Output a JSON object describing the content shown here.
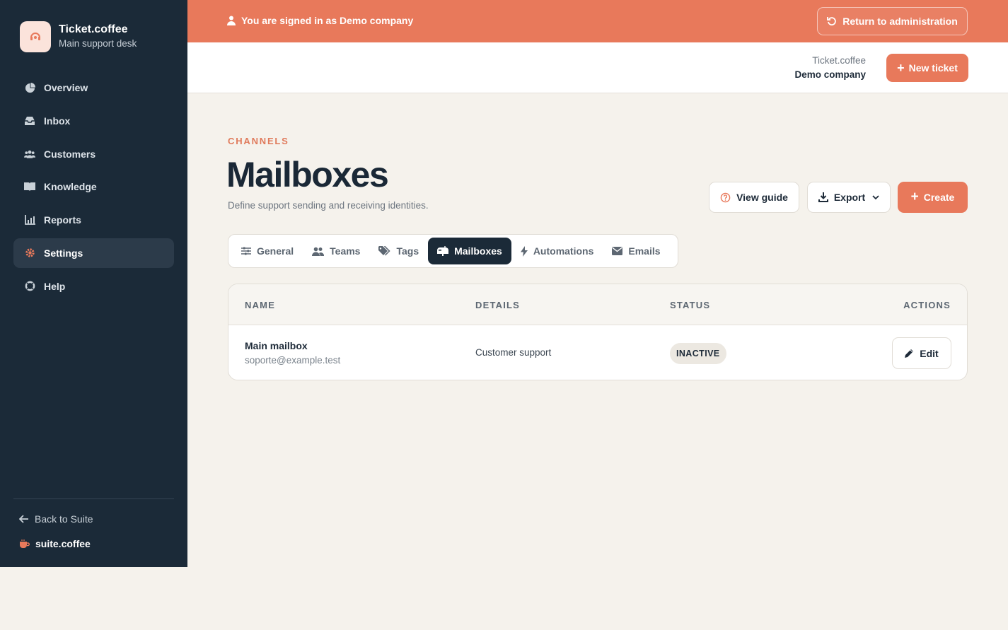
{
  "brand": {
    "name": "Ticket.coffee",
    "subtitle": "Main support desk",
    "logo_icon": "headset-icon"
  },
  "sidebar": {
    "items": [
      {
        "label": "Overview",
        "icon": "pie-chart-icon",
        "active": false
      },
      {
        "label": "Inbox",
        "icon": "inbox-icon",
        "active": false
      },
      {
        "label": "Customers",
        "icon": "users-icon",
        "active": false
      },
      {
        "label": "Knowledge",
        "icon": "book-icon",
        "active": false
      },
      {
        "label": "Reports",
        "icon": "chart-icon",
        "active": false
      },
      {
        "label": "Settings",
        "icon": "gear-icon",
        "active": true
      },
      {
        "label": "Help",
        "icon": "lifebuoy-icon",
        "active": false
      }
    ],
    "back_label": "Back to Suite",
    "suite_name": "suite.coffee"
  },
  "banner": {
    "text": "You are signed in as Demo company",
    "return_label": "Return to administration"
  },
  "header": {
    "app_name": "Ticket.coffee",
    "company": "Demo company",
    "new_ticket_label": "New ticket"
  },
  "page": {
    "eyebrow": "CHANNELS",
    "title": "Mailboxes",
    "description": "Define support sending and receiving identities.",
    "actions": {
      "guide_label": "View guide",
      "export_label": "Export",
      "create_label": "Create"
    }
  },
  "tabs": [
    {
      "label": "General",
      "icon": "sliders-icon",
      "active": false
    },
    {
      "label": "Teams",
      "icon": "team-icon",
      "active": false
    },
    {
      "label": "Tags",
      "icon": "tags-icon",
      "active": false
    },
    {
      "label": "Mailboxes",
      "icon": "mailbox-icon",
      "active": true
    },
    {
      "label": "Automations",
      "icon": "bolt-icon",
      "active": false
    },
    {
      "label": "Emails",
      "icon": "envelope-icon",
      "active": false
    }
  ],
  "table": {
    "headers": {
      "name": "NAME",
      "details": "DETAILS",
      "status": "STATUS",
      "actions": "ACTIONS"
    },
    "rows": [
      {
        "name": "Main mailbox",
        "email": "soporte@example.test",
        "details": "Customer support",
        "status": "INACTIVE",
        "action_label": "Edit"
      }
    ]
  },
  "colors": {
    "accent": "#e8795b",
    "sidebar": "#1b2a38",
    "background": "#f5f2ec"
  }
}
